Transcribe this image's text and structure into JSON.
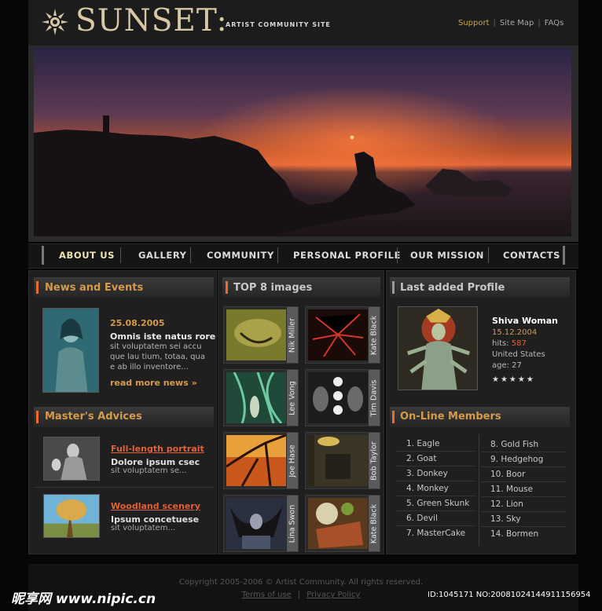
{
  "header": {
    "logo_text": "SUNSET:",
    "tagline": "ARTIST COMMUNITY SITE",
    "links": [
      "Support",
      "Site Map",
      "FAQs"
    ]
  },
  "nav": [
    "ABOUT US",
    "GALLERY",
    "COMMUNITY",
    "PERSONAL PROFILE",
    "OUR MISSION",
    "CONTACTS"
  ],
  "news": {
    "title": "News and Events",
    "date": "25.08.2005",
    "headline": "Omnis iste natus rore",
    "body": [
      "sit voluptatem sei accu",
      "que lau tium, totaa, qua",
      "e ab illo inventore..."
    ],
    "more": "read more news »"
  },
  "advices": {
    "title": "Master's Advices",
    "items": [
      {
        "title": "Full-length portrait",
        "sub": "Dolore ipsum csec",
        "body": "sit voluptatem se..."
      },
      {
        "title": "Woodland scenery",
        "sub": "Ipsum concetuese",
        "body": "sit voluptatem..."
      }
    ]
  },
  "top_images": {
    "title": "TOP 8 images",
    "items": [
      "Nik Miller",
      "Kate Black",
      "Lee Vong",
      "Tim Davis",
      "Joe Hase",
      "Bob Taylor",
      "Lina Swon",
      "Kate Black"
    ]
  },
  "profile": {
    "title": "Last added Profile",
    "name": "Shiva Woman",
    "date": "15.12.2004",
    "hits_label": "hits: ",
    "hits": "587",
    "country": "United States",
    "age": "age: 27",
    "stars": "★★★★★"
  },
  "members": {
    "title": "On-Line Members",
    "left": [
      "1.  Eagle",
      "2.  Goat",
      "3.  Donkey",
      "4.  Monkey",
      "5.  Green Skunk",
      "6.  Devil",
      "7.  MasterCake"
    ],
    "right": [
      "8.  Gold Fish",
      "9.  Hedgehog",
      "10.  Boor",
      "11.  Mouse",
      "12.  Lion",
      "13.  Sky",
      "14.  Bormen"
    ]
  },
  "footer": {
    "copyright": "Copyright 2005-2006 © Artist Community. All rights reserved.",
    "terms": "Terms of use",
    "privacy": "Privacy Policy"
  },
  "watermark": {
    "left": "昵享网 www.nipic.cn",
    "right": "ID:1045171 NO:20081024144911156954"
  }
}
